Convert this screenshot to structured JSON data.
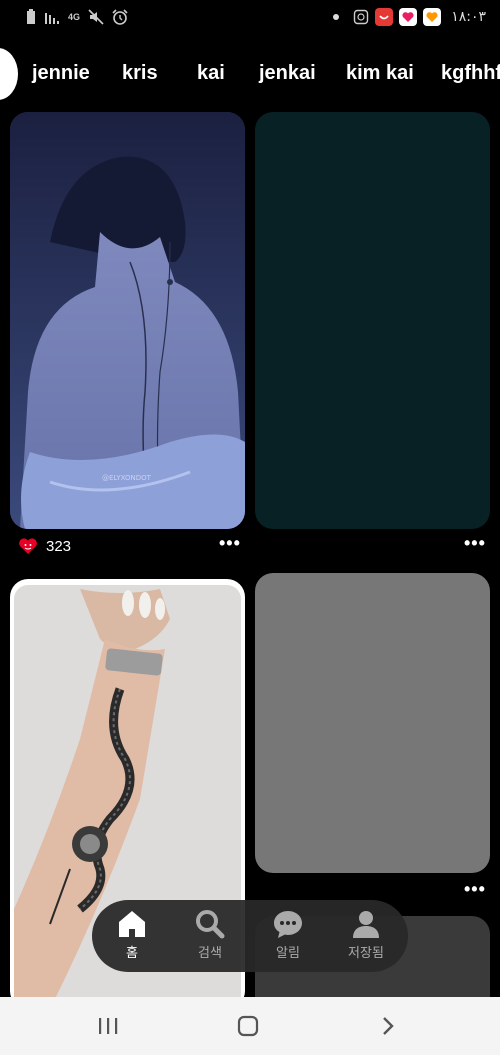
{
  "status_bar": {
    "time": "١٨:٠٣",
    "network": "4G",
    "icons_left": [
      "battery-icon",
      "signal-icon",
      "network-4g-icon",
      "mute-icon",
      "alarm-icon"
    ],
    "icons_right": [
      "notification-dot-icon",
      "screenshot-icon",
      "app-notification-icon",
      "app-notification-icon",
      "app-notification-icon"
    ]
  },
  "board_tabs": [
    "jennie",
    "kris",
    "kai",
    "jenkai",
    "kim kai",
    "kgfhhf"
  ],
  "pins": [
    {
      "image": "back-portrait-image",
      "watermark": "@ELYXONDOT",
      "likes": "323"
    },
    {
      "image": "dark-teal-placeholder"
    },
    {
      "image": "snake-tattoo-arm-image"
    },
    {
      "image": "gray-placeholder"
    },
    {
      "image": "dark-gray-placeholder"
    }
  ],
  "bottom_nav": [
    {
      "label": "홈",
      "icon": "home-icon",
      "active": true
    },
    {
      "label": "검색",
      "icon": "search-icon",
      "active": false
    },
    {
      "label": "알림",
      "icon": "chat-bubble-icon",
      "active": false
    },
    {
      "label": "저장됨",
      "icon": "profile-icon",
      "active": false
    }
  ],
  "colors": {
    "background": "#000000",
    "reaction": "#e60023",
    "nav_bar": "#282828"
  }
}
